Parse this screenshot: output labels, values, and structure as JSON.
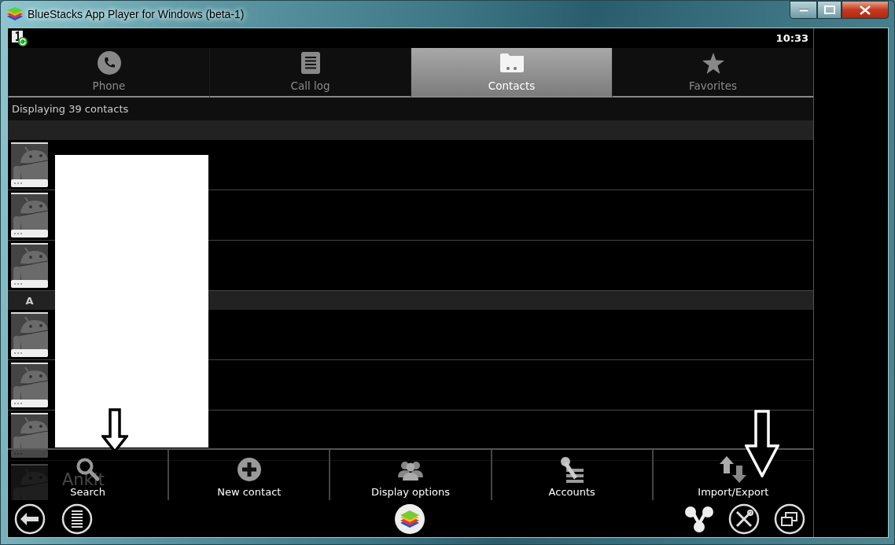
{
  "window": {
    "title": "BlueStacks App Player for Windows (beta-1)"
  },
  "status_bar": {
    "time": "10:33"
  },
  "tabs": [
    {
      "label": "Phone",
      "selected": false
    },
    {
      "label": "Call log",
      "selected": false
    },
    {
      "label": "Contacts",
      "selected": true
    },
    {
      "label": "Favorites",
      "selected": false
    }
  ],
  "summary": "Displaying 39 contacts",
  "sections": [
    {
      "rows": [
        {
          "kind": "contact"
        },
        {
          "kind": "contact"
        },
        {
          "kind": "contact"
        }
      ]
    },
    {
      "letter": "A",
      "rows": [
        {
          "kind": "contact"
        },
        {
          "kind": "contact"
        },
        {
          "kind": "contact"
        },
        {
          "kind": "contact",
          "name": "Ankit"
        }
      ]
    }
  ],
  "menu": [
    {
      "label": "Search"
    },
    {
      "label": "New contact"
    },
    {
      "label": "Display options"
    },
    {
      "label": "Accounts"
    },
    {
      "label": "Import/Export"
    }
  ]
}
